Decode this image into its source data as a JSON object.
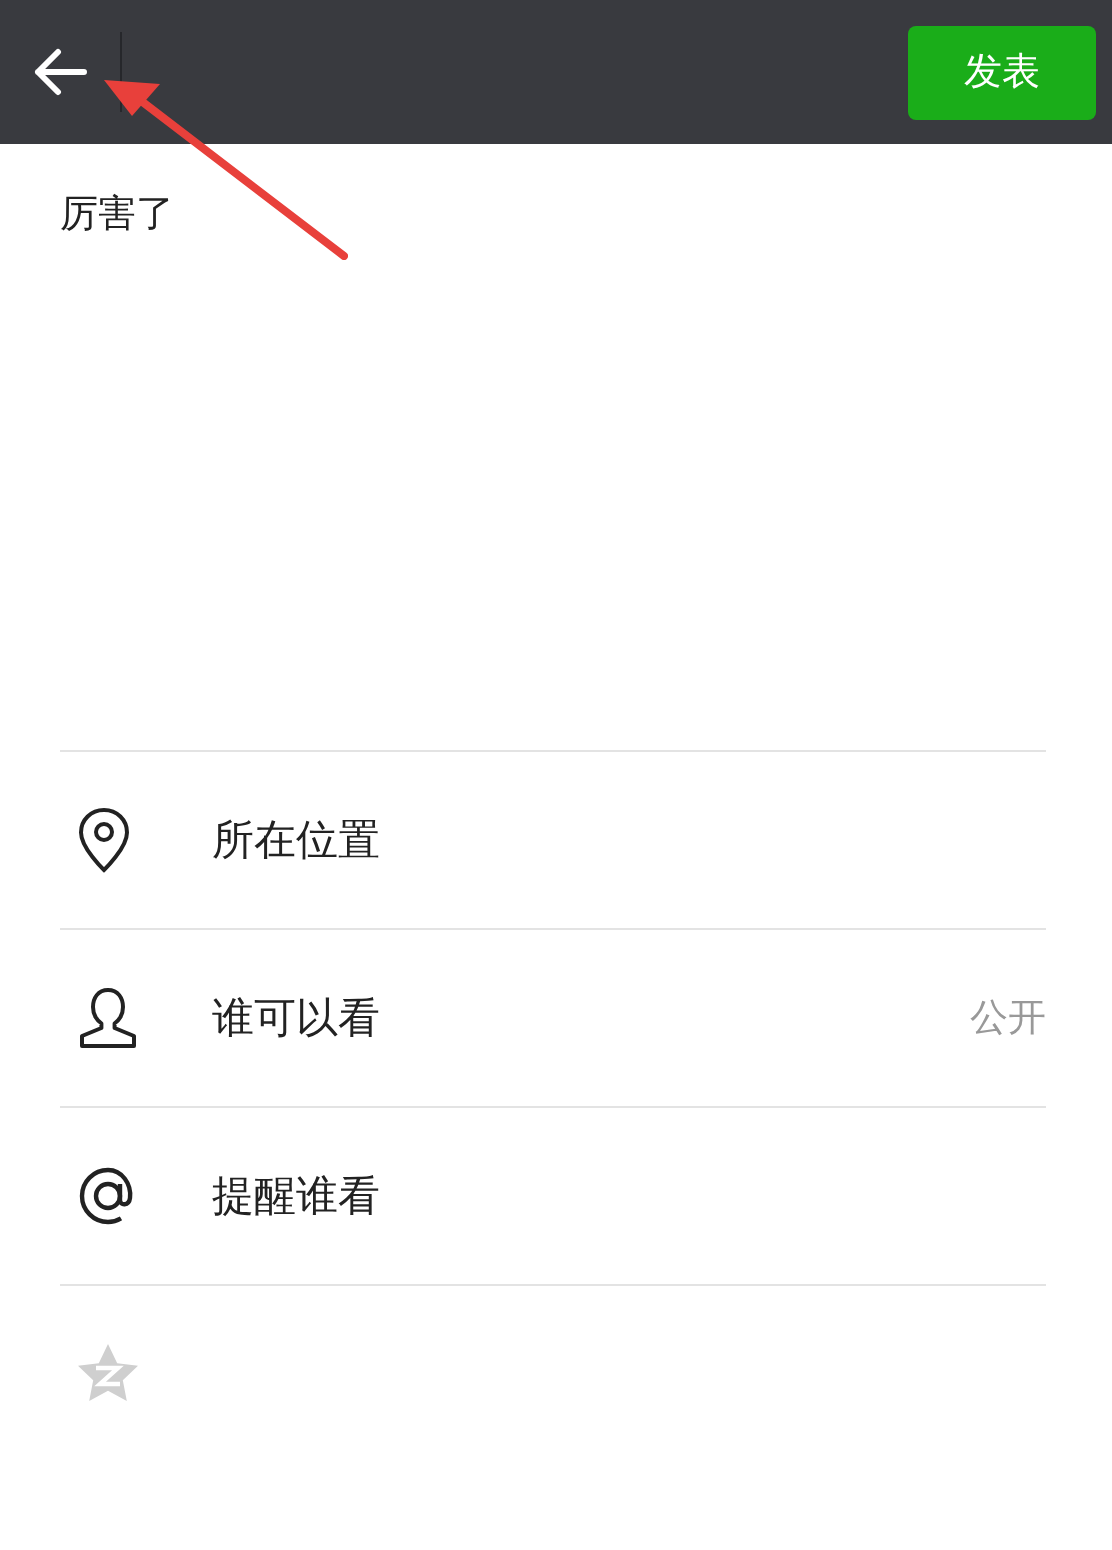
{
  "header": {
    "publish_button": "发表"
  },
  "post": {
    "text": "厉害了"
  },
  "options": [
    {
      "kind": "location",
      "label": "所在位置"
    },
    {
      "kind": "visibility",
      "label": "谁可以看",
      "value": "公开"
    },
    {
      "kind": "mention",
      "label": "提醒谁看"
    },
    {
      "kind": "qzone",
      "on": false
    }
  ]
}
